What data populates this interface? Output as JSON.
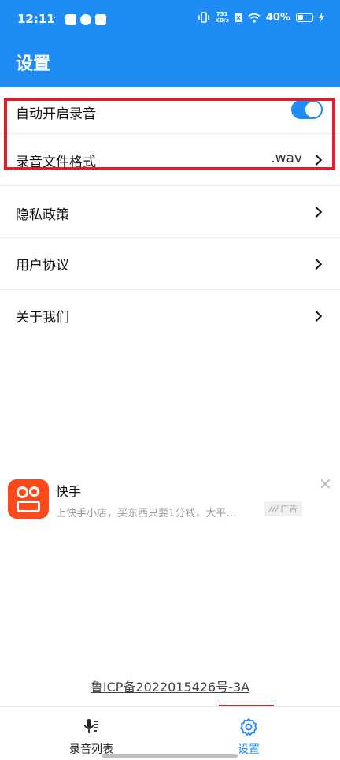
{
  "status_bar": {
    "time": "12:11",
    "dot": "·",
    "net_speed_value": "751",
    "net_speed_unit": "KB/s",
    "battery": "40%"
  },
  "header": {
    "title": "设置"
  },
  "settings": {
    "auto_record": {
      "label": "自动开启录音",
      "enabled": true
    },
    "file_format": {
      "label": "录音文件格式",
      "value": ".wav"
    },
    "privacy": {
      "label": "隐私政策"
    },
    "agreement": {
      "label": "用户协议"
    },
    "about": {
      "label": "关于我们"
    }
  },
  "ad": {
    "title": "快手",
    "description": "上快手小店，买东西只要1分钱，大平…",
    "badge": "广告",
    "close_symbol": "✕",
    "icon": "kuaishou-logo-icon"
  },
  "footer": {
    "icp": "鲁ICP备2022015426号-3A"
  },
  "tabbar": {
    "tabs": [
      {
        "label": "录音列表",
        "icon": "microphone-list-icon",
        "active": false
      },
      {
        "label": "设置",
        "icon": "gear-icon",
        "active": true
      }
    ]
  },
  "colors": {
    "accent": "#1e8cf4",
    "highlight": "#e11b2e",
    "ad_brand": "#fe4a1a"
  }
}
